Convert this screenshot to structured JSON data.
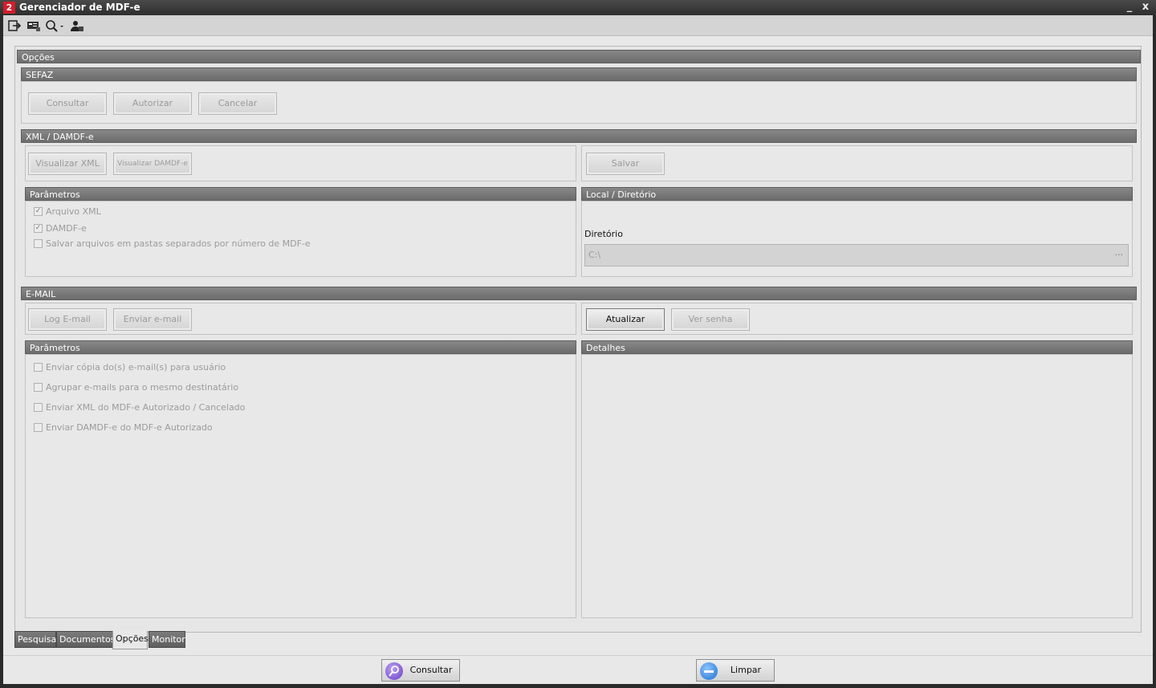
{
  "window": {
    "title": "Gerenciador de MDF-e",
    "minimize": "_",
    "close": "x",
    "logo": "2"
  },
  "toolbar": {
    "icons": [
      "exit-icon",
      "card-icon",
      "search-icon",
      "user-icon"
    ]
  },
  "options": {
    "title": "Opções",
    "sefaz": {
      "title": "SEFAZ",
      "buttons": [
        "Consultar",
        "Autorizar",
        "Cancelar"
      ]
    },
    "xml": {
      "title": "XML / DAMDF-e",
      "buttons": [
        "Visualizar XML",
        "Visualizar DAMDF-e"
      ],
      "save": "Salvar",
      "params": {
        "title": "Parâmetros",
        "items": [
          {
            "label": "Arquivo XML",
            "checked": true
          },
          {
            "label": "DAMDF-e",
            "checked": true
          },
          {
            "label": "Salvar arquivos em pastas separados por número de MDF-e",
            "checked": false
          }
        ]
      },
      "local": {
        "title": "Local / Diretório",
        "dir_label": "Diretório",
        "dir_value": "C:\\",
        "ellipsis": "···"
      }
    },
    "email": {
      "title": "E-MAIL",
      "buttons": [
        "Log E-mail",
        "Enviar e-mail"
      ],
      "refresh": "Atualizar",
      "show_password": "Ver senha",
      "params": {
        "title": "Parâmetros",
        "items": [
          {
            "label": "Enviar cópia do(s) e-mail(s) para usuário",
            "checked": false
          },
          {
            "label": "Agrupar e-mails para o mesmo destinatário",
            "checked": false
          },
          {
            "label": "Enviar XML do MDF-e Autorizado / Cancelado",
            "checked": false
          },
          {
            "label": "Enviar DAMDF-e do MDF-e Autorizado",
            "checked": false
          }
        ]
      },
      "details": {
        "title": "Detalhes"
      }
    }
  },
  "tabs": [
    "Pesquisa",
    "Documentos",
    "Opções",
    "Monitor"
  ],
  "selected_tab": "Opções",
  "bottom": {
    "consultar": "Consultar",
    "limpar": "Limpar"
  },
  "colors": {
    "header": "#7a7a7a",
    "consultar_icon": "#7b4bd6",
    "limpar_icon": "#2a7fd8",
    "logo": "#d31d2b"
  }
}
